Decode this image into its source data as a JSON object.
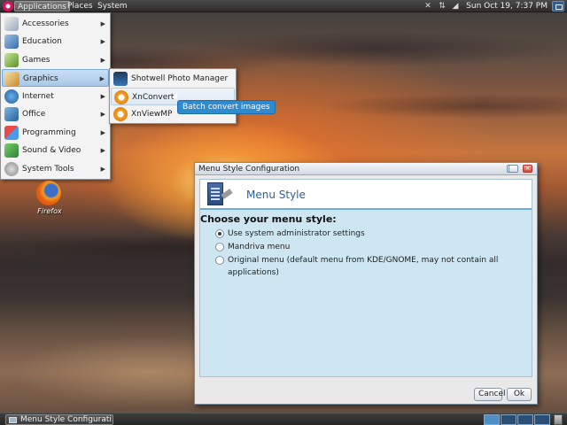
{
  "top_panel": {
    "menus": [
      "Applications",
      "Places",
      "System"
    ],
    "clock": "Sun Oct 19,  7:37 PM",
    "tray_icons": [
      "notification-icon",
      "network-icon",
      "volume-icon"
    ]
  },
  "app_menu": {
    "items": [
      {
        "label": "Accessories",
        "icon": "accessories-icon"
      },
      {
        "label": "Education",
        "icon": "education-icon"
      },
      {
        "label": "Games",
        "icon": "games-icon"
      },
      {
        "label": "Graphics",
        "icon": "graphics-icon"
      },
      {
        "label": "Internet",
        "icon": "internet-icon"
      },
      {
        "label": "Office",
        "icon": "office-icon"
      },
      {
        "label": "Programming",
        "icon": "programming-icon"
      },
      {
        "label": "Sound & Video",
        "icon": "sound-video-icon"
      },
      {
        "label": "System Tools",
        "icon": "system-tools-icon"
      }
    ],
    "active": "Graphics"
  },
  "graphics_submenu": {
    "items": [
      {
        "label": "Shotwell Photo Manager",
        "icon": "shotwell-icon"
      },
      {
        "label": "XnConvert",
        "icon": "xnconvert-icon"
      },
      {
        "label": "XnViewMP",
        "icon": "xnviewmp-icon"
      }
    ],
    "hovered": "XnConvert"
  },
  "tooltip": "Batch convert images",
  "desktop": {
    "icons": [
      {
        "label": "Firefox",
        "icon": "firefox-icon"
      }
    ]
  },
  "dialog": {
    "title": "Menu Style Configuration",
    "header": "Menu Style",
    "prompt": "Choose your menu style:",
    "options": [
      {
        "label": "Use system administrator settings",
        "selected": true
      },
      {
        "label": "Mandriva menu",
        "selected": false
      },
      {
        "label": "Original menu (default menu from KDE/GNOME, may not contain all applications)",
        "selected": false
      }
    ],
    "buttons": {
      "cancel": "Cancel",
      "ok": "Ok"
    }
  },
  "bottom_panel": {
    "task": "Menu Style Configurati...",
    "workspaces": 4,
    "active_workspace": 1
  },
  "colors": {
    "accent_blue": "#2f8bd0",
    "dialog_body": "#cde6f1",
    "header_title": "#2a5f9e"
  }
}
